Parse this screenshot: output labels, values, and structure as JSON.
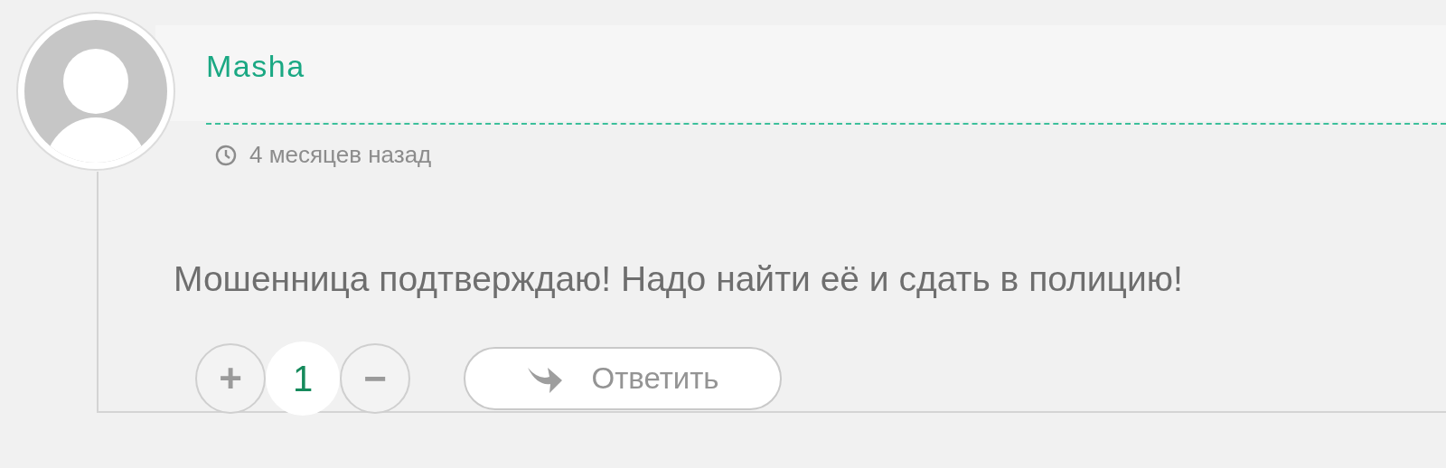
{
  "comment": {
    "author": "Masha",
    "time": "4 месяцев назад",
    "text": "Мошенница подтверждаю! Надо найти её и сдать в полицию!",
    "vote_up": "+",
    "votes": "1",
    "vote_down": "−",
    "reply": "Ответить"
  }
}
